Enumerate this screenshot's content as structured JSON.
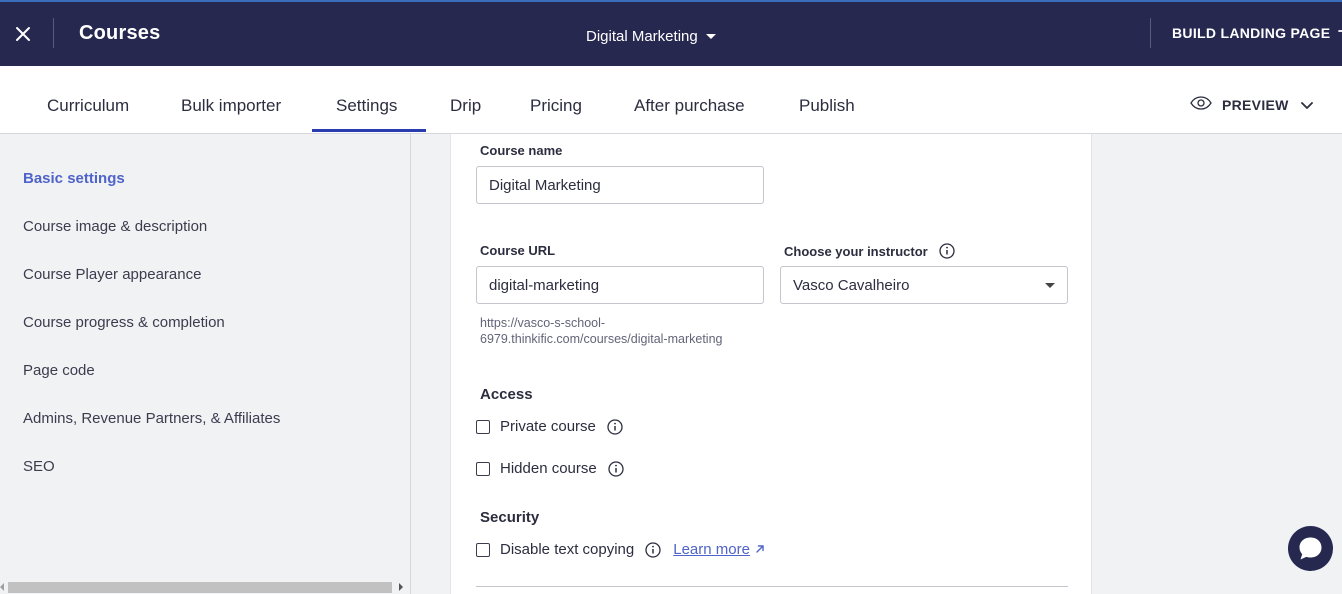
{
  "colors": {
    "topbar_bg": "#262850",
    "accent": "#2a3db0",
    "active_link": "#4f63c8",
    "page_bg": "#f1f2f4"
  },
  "topbar": {
    "close_icon": "close-icon",
    "title": "Courses",
    "course_selector": "Digital Marketing",
    "build_landing_label": "BUILD LANDING PAGE",
    "build_landing_icon": "arrow-right-icon"
  },
  "tabs": {
    "items": [
      {
        "label": "Curriculum"
      },
      {
        "label": "Bulk importer"
      },
      {
        "label": "Settings"
      },
      {
        "label": "Drip"
      },
      {
        "label": "Pricing"
      },
      {
        "label": "After purchase"
      },
      {
        "label": "Publish"
      }
    ],
    "active": "Settings",
    "preview_label": "PREVIEW"
  },
  "sidebar": {
    "items": [
      {
        "label": "Basic settings"
      },
      {
        "label": "Course image & description"
      },
      {
        "label": "Course Player appearance"
      },
      {
        "label": "Course progress & completion"
      },
      {
        "label": "Page code"
      },
      {
        "label": "Admins, Revenue Partners, & Affiliates"
      },
      {
        "label": "SEO"
      }
    ],
    "active": "Basic settings"
  },
  "form": {
    "course_name_label": "Course name",
    "course_name_value": "Digital Marketing",
    "course_url_label": "Course URL",
    "course_url_value": "digital-marketing",
    "course_url_help": "https://vasco-s-school-6979.thinkific.com/courses/digital-marketing",
    "instructor_label": "Choose your instructor",
    "instructor_value": "Vasco Cavalheiro",
    "access_title": "Access",
    "private_course_label": "Private course",
    "private_course_checked": false,
    "hidden_course_label": "Hidden course",
    "hidden_course_checked": false,
    "security_title": "Security",
    "disable_copy_label": "Disable text copying",
    "disable_copy_checked": false,
    "learn_more_label": "Learn more"
  },
  "chat": {
    "icon": "chat-bubble-icon"
  }
}
